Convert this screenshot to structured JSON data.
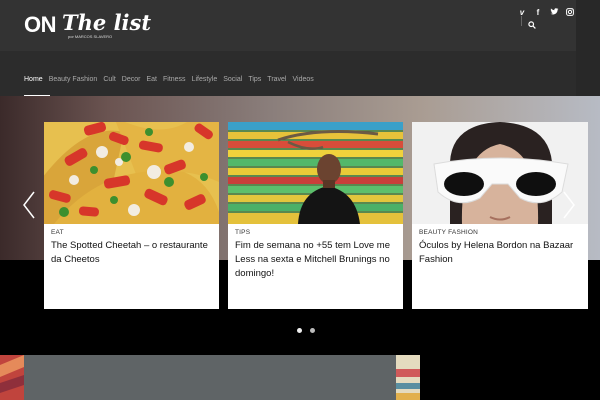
{
  "header": {
    "logo_on": "ON",
    "logo_the_list": "The list",
    "logo_byline": "por MARCOS SLAVERO",
    "social": [
      {
        "icon": "vimeo-icon",
        "glyph": "v"
      },
      {
        "icon": "facebook-icon",
        "glyph": "f"
      },
      {
        "icon": "twitter-icon",
        "glyph": "t"
      },
      {
        "icon": "instagram-icon",
        "glyph": "◎"
      }
    ]
  },
  "nav": {
    "items": [
      "Home",
      "Beauty Fashion",
      "Cult",
      "Decor",
      "Eat",
      "Fitness",
      "Lifestyle",
      "Social",
      "Tips",
      "Travel",
      "Videos"
    ],
    "active": "Home"
  },
  "cards": [
    {
      "category": "EAT",
      "title": "The Spotted Cheetah – o restaurante da Cheetos"
    },
    {
      "category": "TIPS",
      "title": "Fim de semana no +55 tem Love me Less na sexta e Mitchell Brunings no domingo!"
    },
    {
      "category": "BEAUTY FASHION",
      "title": "Óculos by Helena Bordon na Bazaar Fashion"
    }
  ],
  "slider": {
    "pages": 2,
    "active_page": 1
  },
  "colors": {
    "header_bg": "#333333",
    "nav_active": "#ffffff",
    "nav_inactive": "#aaaaaa",
    "card_bg": "#ffffff"
  }
}
